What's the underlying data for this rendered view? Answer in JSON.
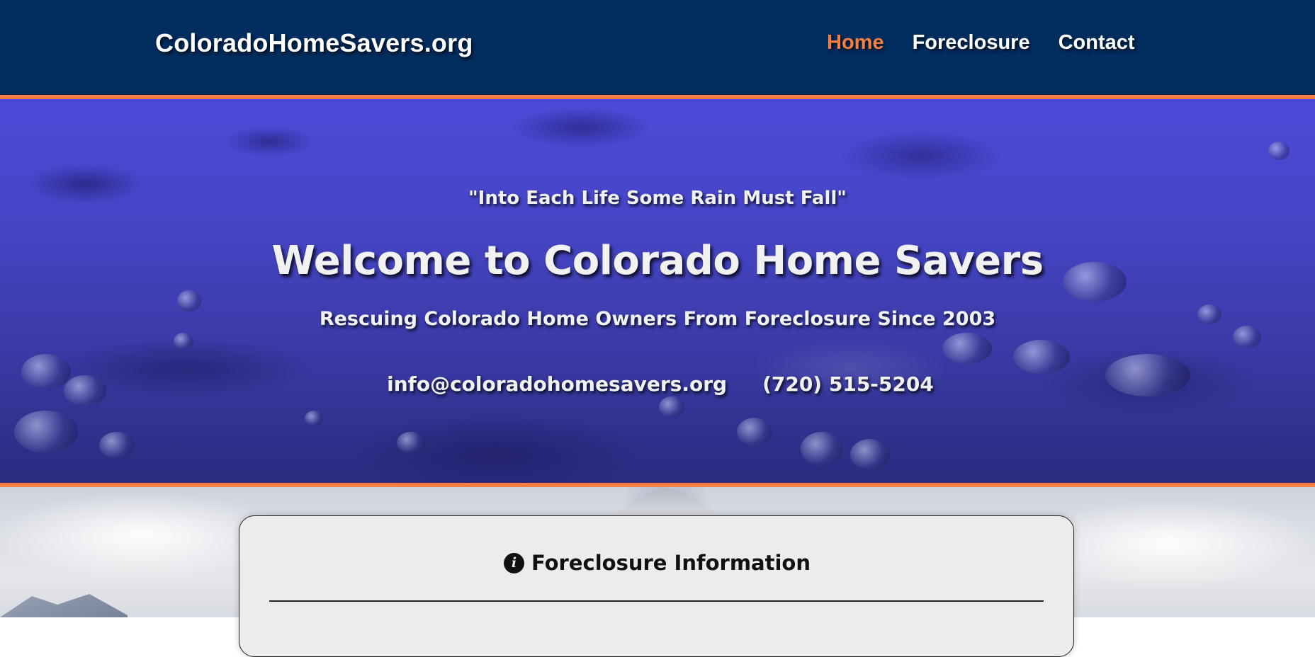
{
  "navbar": {
    "brand": "ColoradoHomeSavers.org",
    "links": [
      {
        "label": "Home",
        "active": true
      },
      {
        "label": "Foreclosure",
        "active": false
      },
      {
        "label": "Contact",
        "active": false
      }
    ]
  },
  "hero": {
    "tagline": "\"Into Each Life Some Rain Must Fall\"",
    "title": "Welcome to Colorado Home Savers",
    "subtitle": "Rescuing Colorado Home Owners From Foreclosure Since 2003",
    "email": "info@coloradohomesavers.org",
    "phone": "(720) 515-5204"
  },
  "info_card": {
    "icon": "info-circle-icon",
    "title": "Foreclosure Information"
  },
  "colors": {
    "navbar_bg": "#022d5f",
    "accent": "#f57f43",
    "hero_overlay": "#4646c8",
    "card_bg": "#ececec"
  }
}
